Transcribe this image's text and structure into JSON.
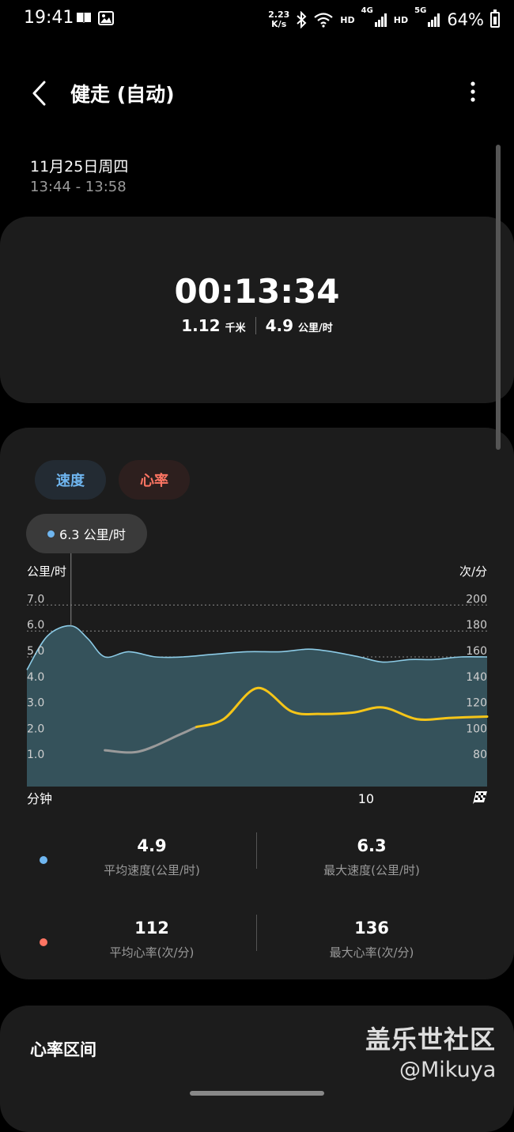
{
  "status_bar": {
    "time": "19:41",
    "net_speed_value": "2.23",
    "net_speed_unit": "K/s",
    "hd1": "HD",
    "net1": "4G",
    "hd2": "HD",
    "net2": "5G",
    "battery": "64%"
  },
  "header": {
    "title": "健走 (自动)"
  },
  "session": {
    "date": "11月25日周四",
    "time_range": "13:44 - 13:58"
  },
  "summary": {
    "duration": "00:13:34",
    "distance": "1.12",
    "distance_unit": "千米",
    "speed": "4.9",
    "speed_unit": "公里/时"
  },
  "tabs": {
    "speed": "速度",
    "heart_rate": "心率"
  },
  "tooltip": {
    "text": "6.3 公里/时"
  },
  "chart_data": {
    "type": "area",
    "left_axis_label": "公里/时",
    "right_axis_label": "次/分",
    "left_ticks": [
      "7.0",
      "6.0",
      "5.0",
      "4.0",
      "3.0",
      "2.0",
      "1.0"
    ],
    "right_ticks": [
      "200",
      "180",
      "160",
      "140",
      "120",
      "100",
      "80"
    ],
    "x_label": "分钟",
    "x_tick": "10",
    "ylim_left": [
      0,
      7.5
    ],
    "ylim_right": [
      60,
      210
    ],
    "xlim": [
      0,
      13.57
    ],
    "series": [
      {
        "unit": "公里/时",
        "color": "#8ccbe6",
        "fill": "#35525b",
        "x": [
          0,
          0.6,
          1.3,
          1.8,
          2.3,
          3.0,
          3.8,
          4.6,
          5.5,
          6.5,
          7.5,
          8.3,
          9.0,
          9.8,
          10.5,
          11.3,
          12.0,
          12.8,
          13.57
        ],
        "y": [
          4.5,
          5.8,
          6.2,
          5.7,
          5.0,
          5.2,
          5.0,
          5.0,
          5.1,
          5.2,
          5.2,
          5.3,
          5.2,
          5.0,
          4.8,
          4.9,
          4.9,
          5.0,
          5.0
        ]
      },
      {
        "unit": "次/分",
        "color": "#f5c518",
        "color_start": "#9a9a9a",
        "x": [
          2.3,
          3.3,
          4.5,
          5.0,
          5.8,
          6.8,
          7.8,
          8.6,
          9.6,
          10.5,
          11.5,
          12.5,
          13.57
        ],
        "y": [
          88,
          87,
          100,
          106,
          112,
          136,
          118,
          116,
          117,
          121,
          112,
          113,
          114
        ]
      }
    ]
  },
  "stats": {
    "avg_speed_value": "4.9",
    "avg_speed_label": "平均速度(公里/时)",
    "max_speed_value": "6.3",
    "max_speed_label": "最大速度(公里/时)",
    "avg_hr_value": "112",
    "avg_hr_label": "平均心率(次/分)",
    "max_hr_value": "136",
    "max_hr_label": "最大心率(次/分)",
    "speed_color": "#6fb6f0",
    "hr_color": "#ff7563"
  },
  "zones": {
    "title": "心率区间"
  },
  "watermark": {
    "line1": "盖乐世社区",
    "line2": "@Mikuya"
  },
  "icons": {
    "back": "chevron-left-icon",
    "more": "more-vertical-icon",
    "finish": "checkered-flag-icon"
  }
}
